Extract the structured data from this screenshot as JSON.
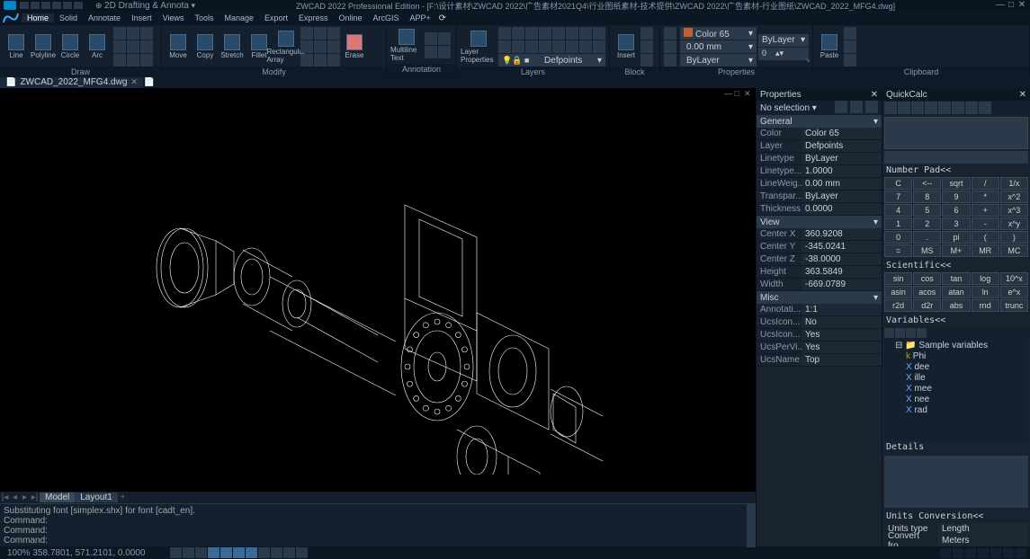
{
  "titlebar": {
    "mode": "2D Drafting & Annota",
    "title": "ZWCAD 2022 Professional Edition - [F:\\设计素材\\ZWCAD 2022\\广告素材2021Q4\\行业图纸素材-技术提供\\ZWCAD 2022\\广告素材-行业图纸\\ZWCAD_2022_MFG4.dwg]"
  },
  "ribbon": {
    "tabs": [
      "Home",
      "Solid",
      "Annotate",
      "Insert",
      "Views",
      "Tools",
      "Manage",
      "Export",
      "Express",
      "Online",
      "ArcGIS",
      "APP+"
    ],
    "active": "Home",
    "panels": {
      "draw": {
        "label": "Draw",
        "big": [
          {
            "name": "line",
            "label": "Line"
          },
          {
            "name": "polyline",
            "label": "Polyline"
          },
          {
            "name": "circle",
            "label": "Circle"
          },
          {
            "name": "arc",
            "label": "Arc"
          }
        ]
      },
      "modify": {
        "label": "Modify",
        "big": [
          {
            "name": "move",
            "label": "Move"
          },
          {
            "name": "copy",
            "label": "Copy"
          },
          {
            "name": "stretch",
            "label": "Stretch"
          },
          {
            "name": "fillet",
            "label": "Fillet"
          },
          {
            "name": "rectarray",
            "label": "Rectangular Array"
          }
        ],
        "erase": {
          "label": "Erase"
        }
      },
      "annotation": {
        "label": "Annotation",
        "text": {
          "label": "Multiline Text"
        }
      },
      "layers": {
        "label": "Layers",
        "props": {
          "label": "Layer Properties"
        },
        "current": "Defpoints"
      },
      "block": {
        "label": "Block",
        "insert": {
          "label": "Insert"
        }
      },
      "properties": {
        "label": "Properties",
        "color": "Color 65",
        "layer": "ByLayer",
        "ltype": "ByLayer",
        "lw": "0.00  mm"
      },
      "clipboard": {
        "label": "Clipboard",
        "paste": {
          "label": "Paste"
        }
      }
    }
  },
  "doctab": {
    "name": "ZWCAD_2022_MFG4.dwg"
  },
  "modeltabs": {
    "model": "Model",
    "layout": "Layout1"
  },
  "cmd": {
    "history": [
      "Substituting font [simplex.shx] for font [cadt_en].",
      "Command:",
      "Command:",
      "Command:"
    ],
    "prompt": "Command: "
  },
  "props_panel": {
    "title": "Properties",
    "selection": "No selection",
    "groups": {
      "general": {
        "title": "General",
        "rows": [
          {
            "k": "Color",
            "v": "Color 65"
          },
          {
            "k": "Layer",
            "v": "Defpoints"
          },
          {
            "k": "Linetype",
            "v": "ByLayer"
          },
          {
            "k": "Linetype...",
            "v": "1.0000"
          },
          {
            "k": "LineWeig...",
            "v": "0.00 mm"
          },
          {
            "k": "Transpar...",
            "v": "ByLayer"
          },
          {
            "k": "Thickness",
            "v": "0.0000"
          }
        ]
      },
      "view": {
        "title": "View",
        "rows": [
          {
            "k": "Center X",
            "v": "360.9208"
          },
          {
            "k": "Center Y",
            "v": "-345.0241"
          },
          {
            "k": "Center Z",
            "v": "-38.0000"
          },
          {
            "k": "Height",
            "v": "363.5849"
          },
          {
            "k": "Width",
            "v": "-669.0789"
          }
        ]
      },
      "misc": {
        "title": "Misc",
        "rows": [
          {
            "k": "Annotati...",
            "v": "1:1"
          },
          {
            "k": "UcsIcon...",
            "v": "No"
          },
          {
            "k": "UcsIcon...",
            "v": "Yes"
          },
          {
            "k": "UcsPerVi...",
            "v": "Yes"
          },
          {
            "k": "UcsName",
            "v": "Top"
          }
        ]
      }
    }
  },
  "quickcalc": {
    "title": "QuickCalc",
    "sections": {
      "numpad": "Number Pad<<",
      "scientific": "Scientific<<",
      "variables": "Variables<<",
      "details": "Details",
      "units": "Units Conversion<<"
    },
    "numpad": [
      "C",
      "<--",
      "sqrt",
      "/",
      "1/x",
      "7",
      "8",
      "9",
      "*",
      "x^2",
      "4",
      "5",
      "6",
      "+",
      "x^3",
      "1",
      "2",
      "3",
      "-",
      "x^y",
      "0",
      ".",
      "pi",
      "(",
      ")",
      "=",
      "MS",
      "M+",
      "MR",
      "MC"
    ],
    "scientific": [
      "sin",
      "cos",
      "tan",
      "log",
      "10^x",
      "asin",
      "acos",
      "atan",
      "ln",
      "e^x",
      "r2d",
      "d2r",
      "abs",
      "rnd",
      "trunc"
    ],
    "vars_root": "Sample variables",
    "vars": [
      {
        "t": "k",
        "n": "Phi"
      },
      {
        "t": "x",
        "n": "dee"
      },
      {
        "t": "x",
        "n": "ille"
      },
      {
        "t": "x",
        "n": "mee"
      },
      {
        "t": "x",
        "n": "nee"
      },
      {
        "t": "x",
        "n": "rad"
      }
    ],
    "conv": [
      {
        "k": "Units type",
        "v": "Length"
      },
      {
        "k": "Convert fro...",
        "v": "Meters"
      }
    ]
  },
  "status": {
    "coords": "100%   358.7801, 571.2101, 0.0000"
  }
}
